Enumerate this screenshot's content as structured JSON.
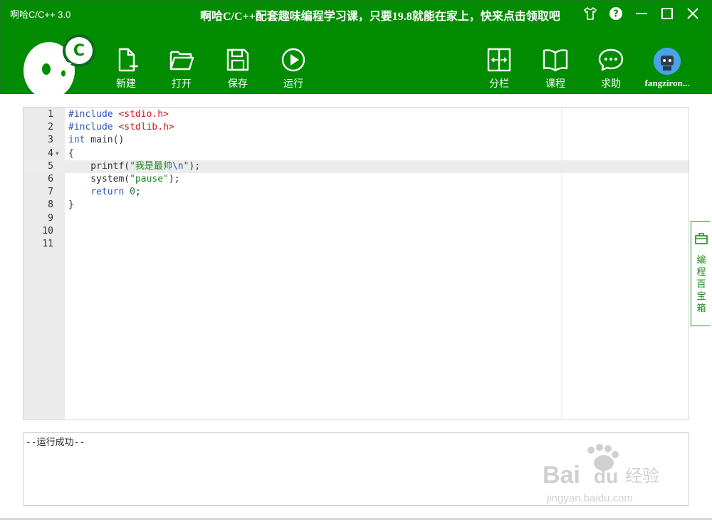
{
  "window": {
    "title": "啊哈C/C++ 3.0",
    "promo": "啊哈C/C++配套趣味编程学习课，只要19.8就能在家上，快来点击领取吧"
  },
  "logo": {
    "letter": "C"
  },
  "toolbar": {
    "new_label": "新建",
    "open_label": "打开",
    "save_label": "保存",
    "run_label": "运行",
    "split_label": "分栏",
    "course_label": "课程",
    "help_label": "求助",
    "username": "fangziron..."
  },
  "editor": {
    "active_line": 5,
    "lines": [
      {
        "n": "1",
        "code": "#include <stdio.h>"
      },
      {
        "n": "2",
        "code": "#include <stdlib.h>"
      },
      {
        "n": "3",
        "code": "int main()"
      },
      {
        "n": "4",
        "code": "{",
        "fold": true
      },
      {
        "n": "5",
        "code": "    printf(\"我是最帅\\n\");"
      },
      {
        "n": "6",
        "code": "    system(\"pause\");"
      },
      {
        "n": "7",
        "code": "    return 0;"
      },
      {
        "n": "8",
        "code": "}"
      },
      {
        "n": "9",
        "code": ""
      },
      {
        "n": "10",
        "code": ""
      },
      {
        "n": "11",
        "code": ""
      }
    ]
  },
  "sidetab": {
    "label": "编程百宝箱"
  },
  "output": {
    "text": "--运行成功--"
  },
  "watermark": {
    "brand": "Bai",
    "brand2": "du",
    "product": "经验",
    "url": "jingyan.baidu.com"
  },
  "colors": {
    "header_green": "#028c02",
    "keyword": "#2a55b5",
    "include": "#c41a16",
    "string": "#1f8a1f"
  }
}
